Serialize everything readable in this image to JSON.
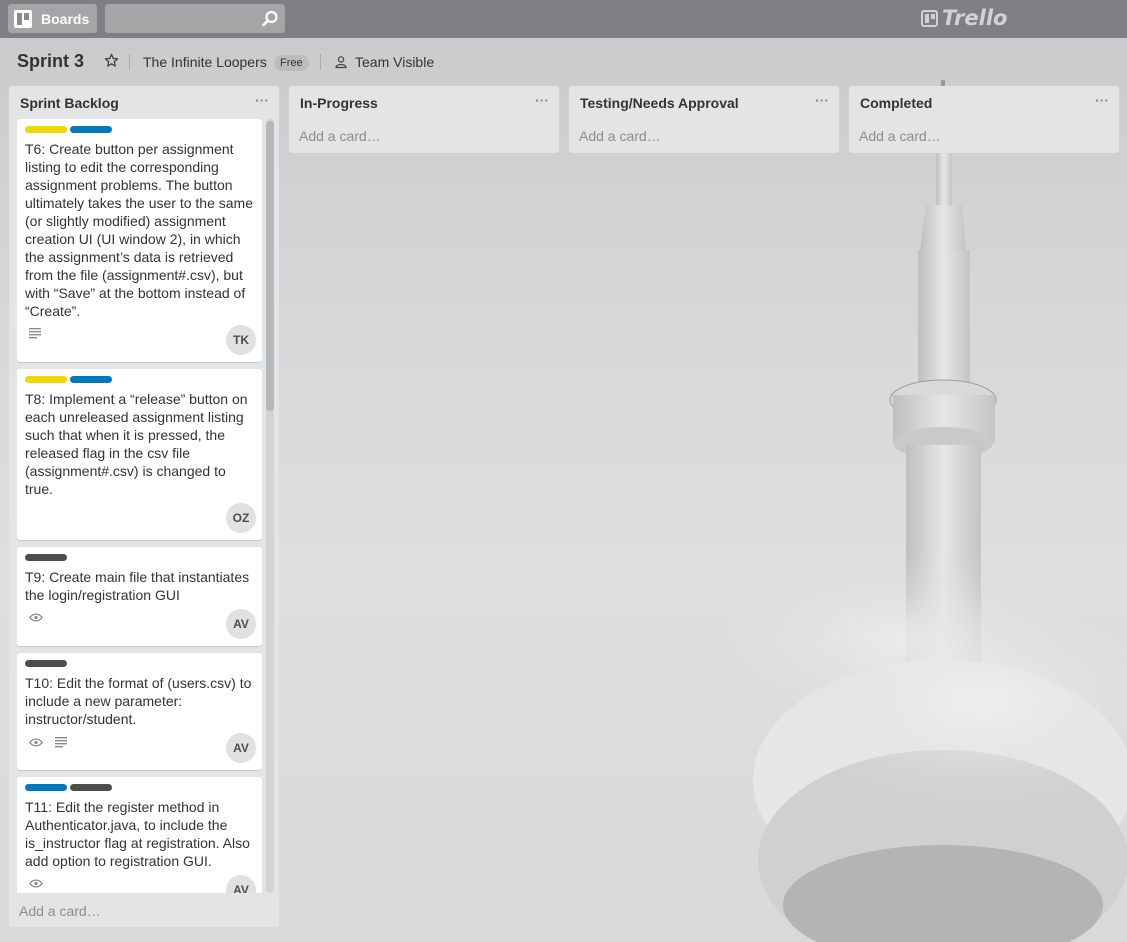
{
  "header": {
    "boards_label": "Boards",
    "search_value": "",
    "logo_text": "Trello"
  },
  "board": {
    "title": "Sprint 3",
    "team": "The Infinite Loopers",
    "plan_badge": "Free",
    "visibility": "Team Visible"
  },
  "colors": {
    "label_yellow": "#f2d600",
    "label_blue": "#0079bf",
    "label_black": "#4d4d4d"
  },
  "lists": [
    {
      "title": "Sprint Backlog",
      "menu": "···",
      "add_card": "Add a card…",
      "cards": [
        {
          "text": "T6: Create button per assignment listing to edit the corresponding assignment problems. The button ultimately takes the user to the same (or slightly modified) assignment creation UI (UI window 2), in which the assignment’s data is retrieved from the file (assignment#.csv), but with “Save” at the bottom instead of “Create”.",
          "labels": [
            "yellow",
            "blue"
          ],
          "badges": [
            "description-icon"
          ],
          "member": "TK"
        },
        {
          "text": "T8: Implement a “release” button on each unreleased assignment listing such that when it is pressed, the released flag in the csv file (assignment#.csv) is changed to true.",
          "labels": [
            "yellow",
            "blue"
          ],
          "badges": [],
          "member": "OZ"
        },
        {
          "text": "T9: Create main file that instantiates the login/registration GUI",
          "labels": [
            "black"
          ],
          "badges": [
            "watch-icon"
          ],
          "member": "AV"
        },
        {
          "text": "T10: Edit the format of (users.csv) to include a new parameter: instructor/student.",
          "labels": [
            "black"
          ],
          "badges": [
            "watch-icon",
            "description-icon"
          ],
          "member": "AV"
        },
        {
          "text": "T11: Edit the register method in Authenticator.java, to include the is_instructor flag at registration. Also add option to registration GUI.",
          "labels": [
            "blue",
            "black"
          ],
          "badges": [
            "watch-icon"
          ],
          "member": "AV"
        }
      ]
    },
    {
      "title": "In-Progress",
      "menu": "···",
      "add_card": "Add a card…"
    },
    {
      "title": "Testing/Needs Approval",
      "menu": "···",
      "add_card": "Add a card…"
    },
    {
      "title": "Completed",
      "menu": "···",
      "add_card": "Add a card…"
    }
  ]
}
